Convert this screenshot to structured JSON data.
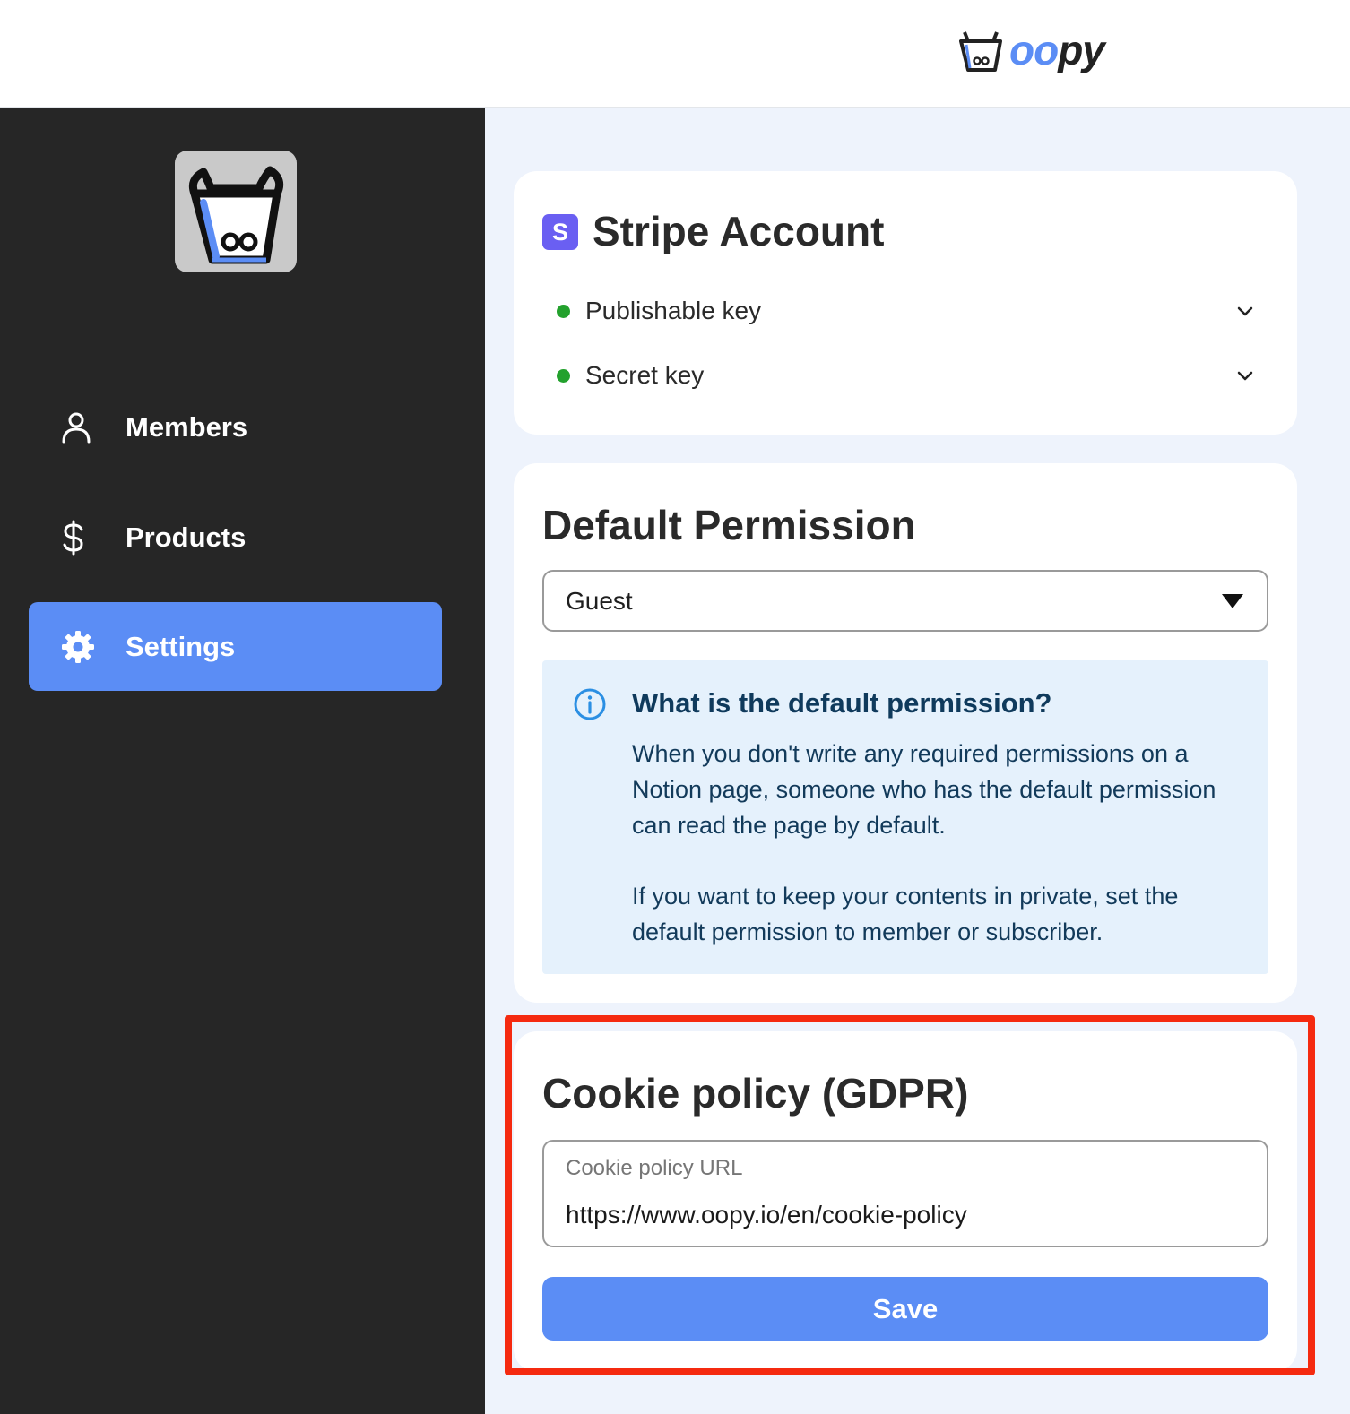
{
  "header": {
    "brand_icon": "cow-logo-icon",
    "brand_text_o": "oo",
    "brand_text_py": "py"
  },
  "sidebar": {
    "logo_icon": "cow-app-icon",
    "items": [
      {
        "label": "Members",
        "icon": "person-icon",
        "active": false
      },
      {
        "label": "Products",
        "icon": "dollar-icon",
        "active": false
      },
      {
        "label": "Settings",
        "icon": "gear-icon",
        "active": true
      }
    ]
  },
  "stripe": {
    "badge": "S",
    "title": "Stripe Account",
    "keys": [
      {
        "label": "Publishable key",
        "status": "green"
      },
      {
        "label": "Secret key",
        "status": "green"
      }
    ]
  },
  "permission": {
    "title": "Default Permission",
    "selected": "Guest",
    "info_title": "What is the default permission?",
    "info_p1": "When you don't write any required permissions on a Notion page, someone who has the default permission can read the page by default.",
    "info_p2": "If you want to keep your contents in private, set the default permission to member or subscriber."
  },
  "cookie": {
    "title": "Cookie policy (GDPR)",
    "field_label": "Cookie policy URL",
    "field_value": "https://www.oopy.io/en/cookie-policy",
    "save_label": "Save"
  },
  "colors": {
    "accent": "#5b8df5",
    "sidebar_bg": "#262626",
    "main_bg": "#eef3fc",
    "status_green": "#23a12d",
    "highlight_red": "#f52a10",
    "stripe_purple": "#6a5ff2"
  }
}
